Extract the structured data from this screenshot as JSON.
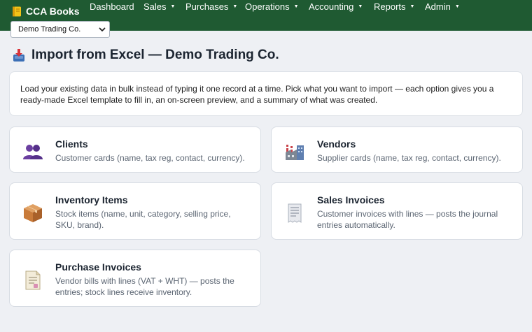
{
  "app": {
    "name": "CCA Books",
    "logo_icon": "notebook-icon"
  },
  "nav": {
    "dashboard": "Dashboard",
    "sales": "Sales",
    "purchases": "Purchases",
    "operations": "Operations",
    "accounting": "Accounting",
    "reports": "Reports",
    "admin": "Admin",
    "caret": "▼"
  },
  "company_select": {
    "value": "Demo Trading Co."
  },
  "page": {
    "title": "Import from Excel — Demo Trading Co.",
    "title_icon": "import-tray-icon"
  },
  "intro": "Load your existing data in bulk instead of typing it one record at a time. Pick what you want to import — each option gives you a ready-made Excel template to fill in, an on-screen preview, and a summary of what was created.",
  "cards": [
    {
      "title": "Clients",
      "desc": "Customer cards (name, tax reg, contact, currency).",
      "icon": "people-icon"
    },
    {
      "title": "Vendors",
      "desc": "Supplier cards (name, tax reg, contact, currency).",
      "icon": "factory-icon"
    },
    {
      "title": "Inventory Items",
      "desc": "Stock items (name, unit, category, selling price, SKU, brand).",
      "icon": "package-icon"
    },
    {
      "title": "Sales Invoices",
      "desc": "Customer invoices with lines — posts the journal entries automatically.",
      "icon": "receipt-icon"
    },
    {
      "title": "Purchase Invoices",
      "desc": "Vendor bills with lines (VAT + WHT) — posts the entries; stock lines receive inventory.",
      "icon": "bill-icon"
    }
  ],
  "colors": {
    "topbar": "#1f5a32",
    "background": "#eef0f4",
    "card": "#ffffff"
  }
}
